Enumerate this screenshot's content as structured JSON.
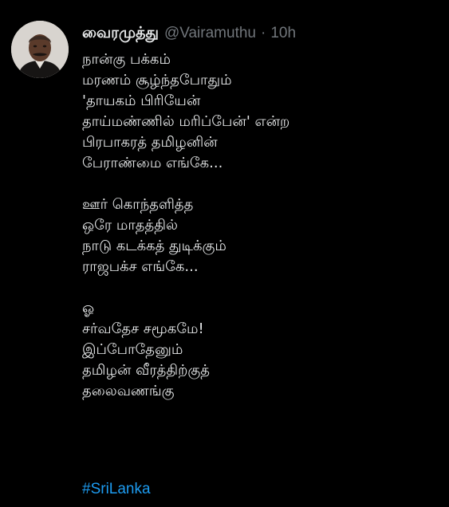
{
  "tweet": {
    "author": {
      "display_name": "வைரமுத்து",
      "handle": "@Vairamuthu",
      "separator": "·",
      "time": "10h"
    },
    "stanzas": [
      [
        "நான்கு பக்கம்",
        "மரணம் சூழ்ந்தபோதும்",
        "'தாயகம் பிரியேன்",
        "தாய்மண்ணில் மரிப்பேன்' என்ற",
        "பிரபாகரத் தமிழனின்",
        "பேராண்மை எங்கே..."
      ],
      [
        "ஊர் கொந்தளித்த",
        "ஒரே மாதத்தில்",
        "நாடு கடக்கத் துடிக்கும்",
        "ராஜபக்ச எங்கே..."
      ],
      [
        "ஓ",
        "சர்வதேச சமூகமே!",
        "இப்போதேனும்",
        "தமிழன் வீரத்திற்குத்",
        "தலைவணங்கு"
      ]
    ],
    "hashtag": "#SriLanka"
  },
  "colors": {
    "background": "#000000",
    "text": "#e7e9ea",
    "muted": "#71767b",
    "link": "#1d9bf0"
  },
  "icons": {
    "avatar": "profile-photo"
  }
}
